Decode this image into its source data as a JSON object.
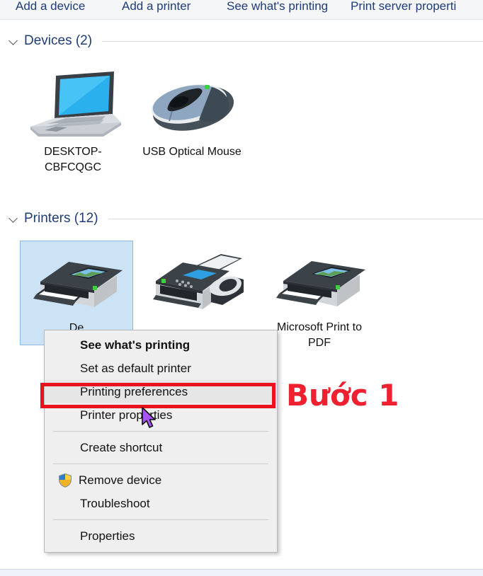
{
  "command_bar": {
    "items": [
      {
        "label": "Add a device",
        "name": "add-a-device"
      },
      {
        "label": "Add a printer",
        "name": "add-a-printer"
      },
      {
        "label": "See what's printing",
        "name": "see-whats-printing"
      },
      {
        "label": "Print server properti",
        "name": "print-server-properties"
      }
    ]
  },
  "groups": {
    "devices": {
      "title": "Devices (2)",
      "chevron": "chevron-down-icon"
    },
    "printers": {
      "title": "Printers (12)",
      "chevron": "chevron-down-icon"
    }
  },
  "devices": [
    {
      "label": "DESKTOP-CBFCQGC",
      "icon": "laptop-icon"
    },
    {
      "label": "USB Optical Mouse",
      "icon": "mouse-icon"
    }
  ],
  "printers": [
    {
      "label": "De",
      "icon": "printer-icon",
      "selected": true
    },
    {
      "label": "",
      "icon": "fax-machine-icon",
      "selected": false
    },
    {
      "label": "Microsoft Print to PDF",
      "icon": "printer-icon",
      "selected": false
    }
  ],
  "context_menu": {
    "items": [
      {
        "label": "See what's printing",
        "bold": true,
        "icon": null,
        "highlighted": false,
        "name": "menu-see-whats-printing"
      },
      {
        "label": "Set as default printer",
        "bold": false,
        "icon": null,
        "highlighted": false,
        "name": "menu-set-as-default-printer"
      },
      {
        "label": "Printing preferences",
        "bold": false,
        "icon": null,
        "highlighted": true,
        "name": "menu-printing-preferences"
      },
      {
        "label": "Printer properties",
        "bold": false,
        "icon": null,
        "highlighted": false,
        "name": "menu-printer-properties"
      },
      {
        "separator": true
      },
      {
        "label": "Create shortcut",
        "bold": false,
        "icon": null,
        "highlighted": false,
        "name": "menu-create-shortcut"
      },
      {
        "separator": true
      },
      {
        "label": "Remove device",
        "bold": false,
        "icon": "uac-shield-icon",
        "highlighted": false,
        "name": "menu-remove-device"
      },
      {
        "label": "Troubleshoot",
        "bold": false,
        "icon": null,
        "highlighted": false,
        "name": "menu-troubleshoot"
      },
      {
        "separator": true
      },
      {
        "label": "Properties",
        "bold": false,
        "icon": null,
        "highlighted": false,
        "name": "menu-properties"
      }
    ]
  },
  "annotation": {
    "text": "Bước 1",
    "color": "#ef2130"
  },
  "colors": {
    "accent_link": "#1f3c78",
    "selection": "#cce3f6",
    "annotation_red": "#e8131f",
    "menu_bg": "#efefef",
    "commandbar_bg": "#f5f6f7"
  }
}
